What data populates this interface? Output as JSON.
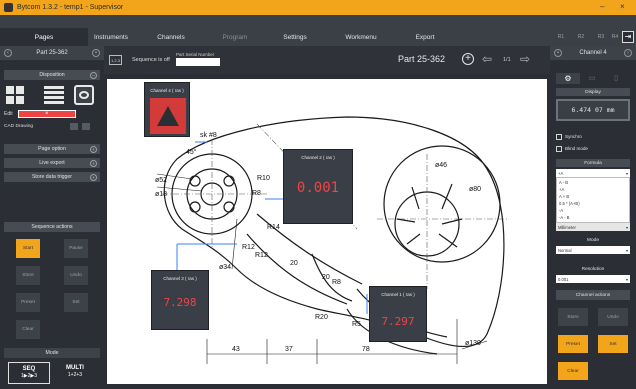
{
  "titlebar": {
    "title": "Bytcom 1.3.2 - temp1 - Supervisor",
    "min": "–",
    "close": "×"
  },
  "menu": {
    "items": [
      {
        "label": "Pages",
        "state": "active"
      },
      {
        "label": "Instruments",
        "state": "normal"
      },
      {
        "label": "Channels",
        "state": "normal"
      },
      {
        "label": "Program",
        "state": "dim"
      },
      {
        "label": "Settings",
        "state": "normal"
      },
      {
        "label": "Workmenu",
        "state": "normal"
      },
      {
        "label": "Export",
        "state": "normal"
      }
    ],
    "right_small": [
      "R1",
      "R2",
      "R3",
      "R4"
    ]
  },
  "left": {
    "header": "Part 25-362",
    "disposition": "Disposition",
    "edit_label": "Edit",
    "cad_label": "CAD Drawing",
    "sections": [
      "Page option",
      "Live export",
      "Store data trigger"
    ],
    "sequence_actions": "Sequence actions",
    "buttons": [
      {
        "label": "Start",
        "style": "orange"
      },
      {
        "label": "Pause",
        "style": "normal"
      },
      {
        "label": "Store",
        "style": "normal"
      },
      {
        "label": "Undo",
        "style": "normal"
      },
      {
        "label": "Preset",
        "style": "normal"
      },
      {
        "label": "Set",
        "style": "normal"
      },
      {
        "label": "Clear",
        "style": "normal"
      }
    ],
    "mode": "Mode",
    "seq": {
      "label": "SEQ",
      "sub": "1▶2▶3"
    },
    "multi": {
      "label": "MULTI",
      "sub": "1+2+3"
    }
  },
  "toolbar": {
    "seq_icon": "1,2,3",
    "sequence_text": "Sequence is off",
    "serial_label": "Part Serial Number",
    "part_title": "Part 25-362",
    "pager": "1/1"
  },
  "channels": [
    {
      "name": "Channel 4 ( ras )",
      "value": ""
    },
    {
      "name": "Channel 2 ( ras )",
      "value": "0.001"
    },
    {
      "name": "Channel 3 ( ras )",
      "value": "7.298"
    },
    {
      "name": "Channel 1 ( ras )",
      "value": "7.297"
    }
  ],
  "drawing_labels": {
    "sk8": "sk #8",
    "d52": "ø52",
    "d18": "ø18",
    "a45": "45°",
    "r10": "R10",
    "r8a": "R8",
    "r14": "R14",
    "r12a": "R12",
    "r12b": "R12",
    "d34": "ø34",
    "n20a": "20",
    "d46": "ø46",
    "d80": "ø80",
    "r8b": "R8",
    "r20": "R20",
    "n20b": "20",
    "r5": "R5",
    "d130": "ø130",
    "dim43": "43",
    "dim37": "37",
    "dim78": "78"
  },
  "right": {
    "header": "Channel 4",
    "display_label": "Display",
    "display_value": "6.474 07 mm",
    "synchro": "Synchro",
    "blind_mode": "Blind mode",
    "formula_label": "Formula",
    "formula_value": "+A",
    "formula_options": [
      "A - B",
      "+A",
      "A + B",
      "0.5 * (A+B)",
      "-A",
      "-A - B"
    ],
    "unit_value": "Millimeter",
    "mode_label": "Mode",
    "mode_value": "Normal",
    "resolution_label": "Resolution",
    "resolution_value": "0.001",
    "channel_actions": "Channel actions",
    "buttons": [
      {
        "label": "Store",
        "style": "normal"
      },
      {
        "label": "Undo",
        "style": "normal"
      },
      {
        "label": "Preset",
        "style": "orange"
      },
      {
        "label": "Set",
        "style": "orange"
      },
      {
        "label": "Clear",
        "style": "orange"
      }
    ]
  },
  "colors": {
    "accent": "#f2a51a",
    "value_red": "#ef4444",
    "panel": "#2b2f35"
  }
}
